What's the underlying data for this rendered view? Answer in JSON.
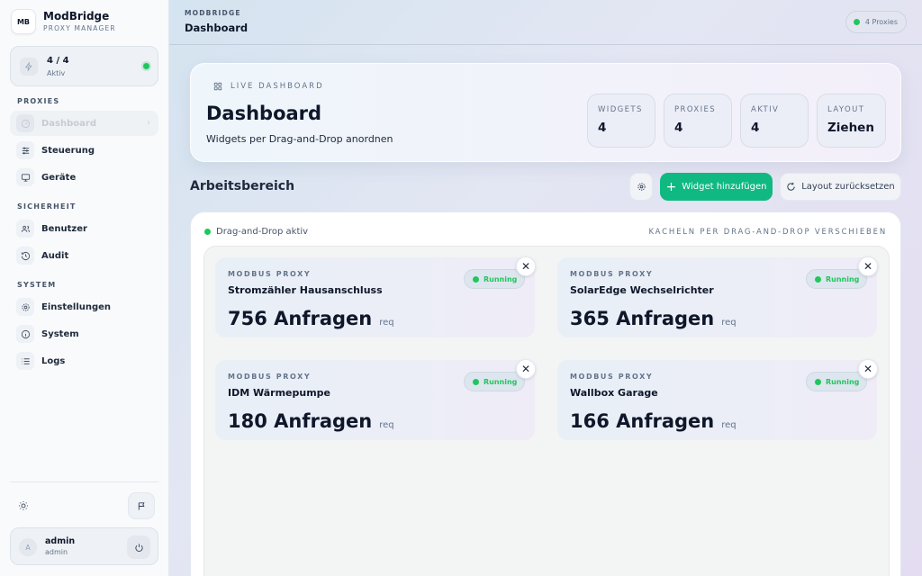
{
  "brand": {
    "logo": "MB",
    "name": "ModBridge",
    "subtitle": "PROXY MANAGER"
  },
  "status": {
    "count": "4 / 4",
    "label": "Aktiv",
    "icon": "bolt-icon",
    "color": "#22c55e"
  },
  "nav": {
    "sections": {
      "proxies": "PROXIES",
      "security": "SICHERHEIT",
      "system": "SYSTEM"
    },
    "items": [
      {
        "label": "Dashboard",
        "icon": "dashboard-icon",
        "active": true
      },
      {
        "label": "Steuerung",
        "icon": "sliders-icon"
      },
      {
        "label": "Geräte",
        "icon": "monitor-icon"
      },
      {
        "label": "Benutzer",
        "icon": "users-icon"
      },
      {
        "label": "Audit",
        "icon": "history-icon"
      },
      {
        "label": "Einstellungen",
        "icon": "gear-icon"
      },
      {
        "label": "System",
        "icon": "info-icon"
      },
      {
        "label": "Logs",
        "icon": "list-icon"
      }
    ]
  },
  "user": {
    "avatar": "A",
    "name": "admin",
    "role": "admin"
  },
  "header": {
    "breadcrumb": "MODBRIDGE",
    "title": "Dashboard",
    "pill": "4 Proxies"
  },
  "hero": {
    "kicker": "LIVE DASHBOARD",
    "title": "Dashboard",
    "subtitle": "Widgets per Drag-and-Drop anordnen",
    "stats": [
      {
        "label": "WIDGETS",
        "value": "4"
      },
      {
        "label": "PROXIES",
        "value": "4"
      },
      {
        "label": "AKTIV",
        "value": "4"
      },
      {
        "label": "LAYOUT",
        "value": "Ziehen"
      }
    ]
  },
  "workspace": {
    "title": "Arbeitsbereich",
    "add_label": "Widget hinzufügen",
    "reset_label": "Layout zurücksetzen",
    "dnd_status": "Drag-and-Drop aktiv",
    "dnd_hint": "KACHELN PER DRAG-AND-DROP VERSCHIEBEN",
    "accent_color": "#10b981"
  },
  "tiles": [
    {
      "type": "MODBUS PROXY",
      "name": "Stromzähler Hausanschluss",
      "count": "756 Anfragen",
      "unit": "req",
      "status": "Running"
    },
    {
      "type": "MODBUS PROXY",
      "name": "SolarEdge Wechselrichter",
      "count": "365 Anfragen",
      "unit": "req",
      "status": "Running"
    },
    {
      "type": "MODBUS PROXY",
      "name": "IDM Wärmepumpe",
      "count": "180 Anfragen",
      "unit": "req",
      "status": "Running"
    },
    {
      "type": "MODBUS PROXY",
      "name": "Wallbox Garage",
      "count": "166 Anfragen",
      "unit": "req",
      "status": "Running"
    }
  ]
}
